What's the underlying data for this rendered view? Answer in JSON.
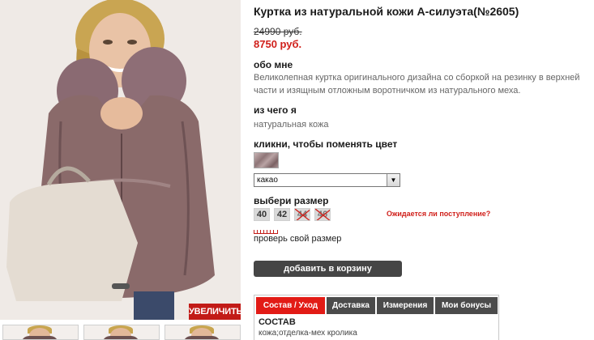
{
  "product": {
    "title": "Куртка из натуральной кожи А-силуэта(№2605)",
    "old_price": "24990 руб.",
    "new_price": "8750 руб."
  },
  "about": {
    "heading": "обо мне",
    "text": "Великолепная куртка оригинального дизайна со сборкой на резинку в верхней части и изящным отложным воротничком из натурального меха."
  },
  "material": {
    "heading": "из чего я",
    "text": "натуральная кожа"
  },
  "color": {
    "heading": "кликни, чтобы поменять цвет",
    "selected": "какао",
    "swatch_color": "#8e7577"
  },
  "size": {
    "heading": "выбери размер",
    "options": [
      {
        "label": "40",
        "available": true
      },
      {
        "label": "42",
        "available": true
      },
      {
        "label": "44",
        "available": false
      },
      {
        "label": "46",
        "available": false
      }
    ],
    "ask_link": "Ожидается ли поступление?",
    "check_link": "проверь свой размер"
  },
  "cart_button": "добавить в корзину",
  "gallery": {
    "zoom_label": "УВЕЛИЧИТЬ"
  },
  "tabs": [
    {
      "label": "Состав / Уход",
      "active": true
    },
    {
      "label": "Доставка",
      "active": false
    },
    {
      "label": "Измерения",
      "active": false
    },
    {
      "label": "Мои бонусы",
      "active": false
    }
  ],
  "composition": {
    "heading": "СОСТАВ",
    "text": "кожа;отделка-мех кролика"
  },
  "colors": {
    "accent": "#e21b16",
    "dark_button": "#454545",
    "price_red": "#d0201b"
  }
}
